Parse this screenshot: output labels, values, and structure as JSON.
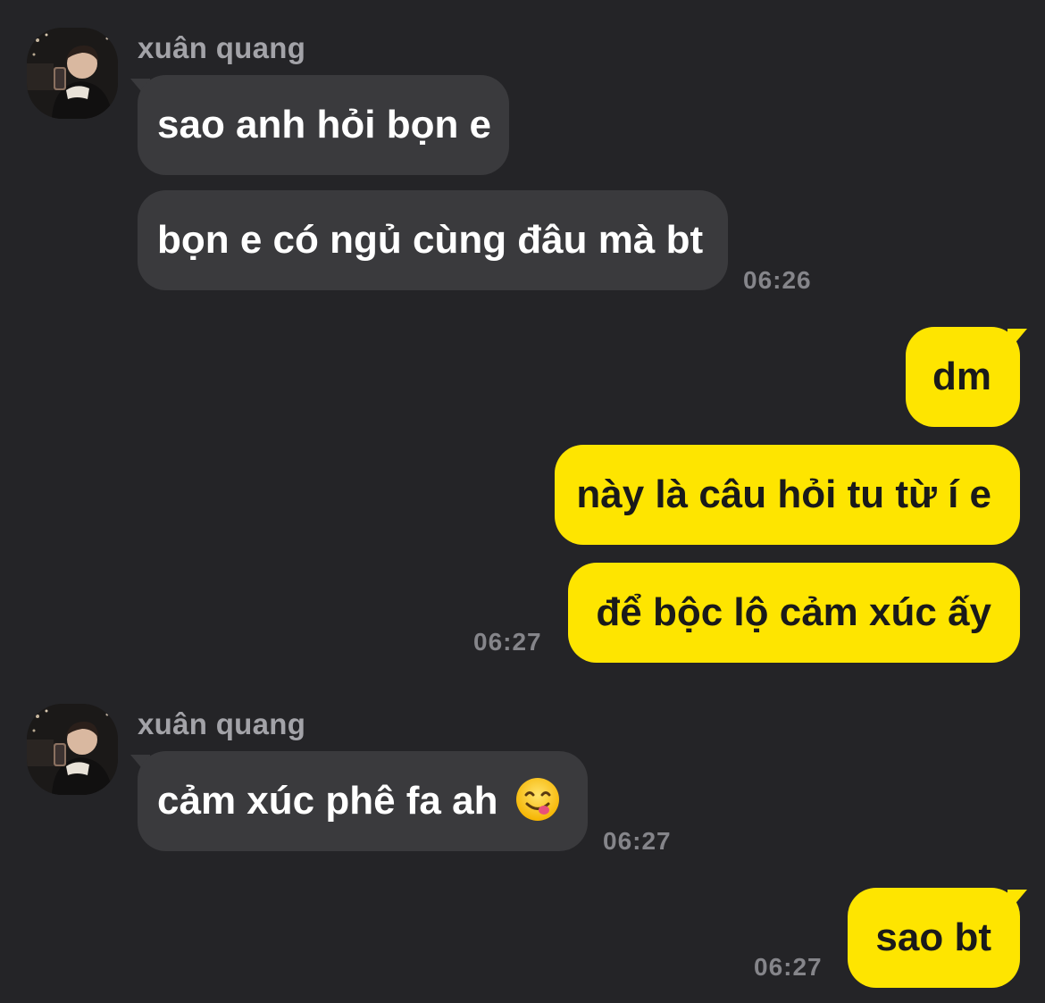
{
  "messages": [
    {
      "sender": "xuân quang",
      "text": "sao anh hỏi bọn e"
    },
    {
      "text": "bọn e có ngủ cùng đâu mà bt",
      "time": "06:26"
    },
    {
      "text": "dm"
    },
    {
      "text": "này là câu hỏi tu từ í e"
    },
    {
      "text": "để bộc lộ cảm xúc ấy",
      "time": "06:27"
    },
    {
      "sender": "xuân quang",
      "text": "cảm xúc phê fa ah",
      "emoji": "face-savoring-food-emoji",
      "time": "06:27"
    },
    {
      "text": "sao bt",
      "time": "06:27"
    }
  ],
  "colors": {
    "background": "#242427",
    "incoming_bubble": "#3a3a3d",
    "outgoing_bubble": "#fee500",
    "sender_name": "#a3a3a8",
    "timestamp": "#85858a"
  }
}
